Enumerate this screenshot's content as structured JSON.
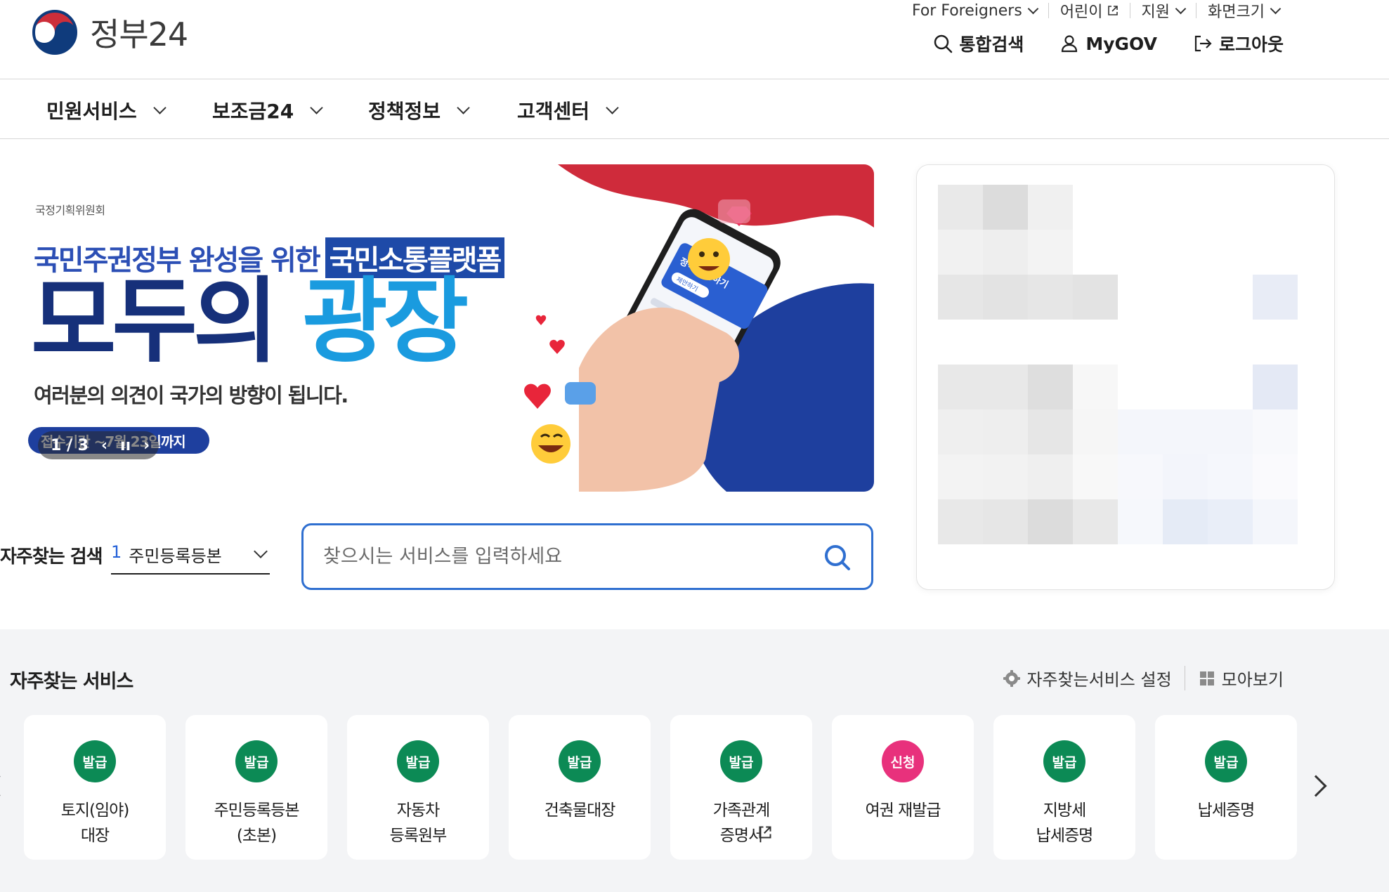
{
  "header": {
    "logo_text": "정부24",
    "util": [
      {
        "label": "For Foreigners",
        "icon": "chevron-down-icon"
      },
      {
        "label": "어린이",
        "icon": "external-link-icon"
      },
      {
        "label": "지원",
        "icon": "chevron-down-icon"
      },
      {
        "label": "화면크기",
        "icon": "chevron-down-icon"
      }
    ],
    "actions": [
      {
        "label": "통합검색",
        "icon": "search-icon"
      },
      {
        "label": "MyGOV",
        "icon": "user-icon"
      },
      {
        "label": "로그아웃",
        "icon": "logout-icon"
      }
    ]
  },
  "nav": {
    "items": [
      {
        "label": "민원서비스"
      },
      {
        "label": "보조금24"
      },
      {
        "label": "정책정보"
      },
      {
        "label": "고객센터"
      }
    ]
  },
  "banner": {
    "org": "국정기획위원회",
    "line1": "국민주권정부 완성을 위한",
    "line1_highlight": "국민소통플랫폼",
    "big_a": "모두의",
    "big_b": "광장",
    "sub": "여러분의 의견이 국가의 방향이 됩니다.",
    "period": "접수기간 ~7월 23일까지",
    "pager": "1 / 3",
    "phone_card_title": "정책 제안하기",
    "phone_card_button": "제안하기"
  },
  "search": {
    "freq_label": "자주찾는 검색",
    "freq_rank": "1",
    "freq_value": "주민등록등본",
    "placeholder": "찾으시는 서비스를 입력하세요"
  },
  "services": {
    "title": "자주찾는 서비스",
    "settings_label": "자주찾는서비스 설정",
    "view_all_label": "모아보기",
    "items": [
      {
        "badge": "발급",
        "badge_color": "#0c8a55",
        "label": "토지(임야)\n대장"
      },
      {
        "badge": "발급",
        "badge_color": "#0c8a55",
        "label": "주민등록등본\n(초본)"
      },
      {
        "badge": "발급",
        "badge_color": "#0c8a55",
        "label": "자동차\n등록원부"
      },
      {
        "badge": "발급",
        "badge_color": "#0c8a55",
        "label": "건축물대장"
      },
      {
        "badge": "발급",
        "badge_color": "#0c8a55",
        "label": "가족관계\n증명서"
      },
      {
        "badge": "신청",
        "badge_color": "#e8317c",
        "label": "여권 재발급"
      },
      {
        "badge": "발급",
        "badge_color": "#0c8a55",
        "label": "지방세\n납세증명"
      },
      {
        "badge": "발급",
        "badge_color": "#0c8a55",
        "label": "납세증명"
      }
    ]
  },
  "colors": {
    "primary": "#2f6fd0",
    "navy": "#16307a",
    "sky": "#1a9bdf",
    "issue_green": "#0c8a55",
    "apply_pink": "#e8317c"
  }
}
